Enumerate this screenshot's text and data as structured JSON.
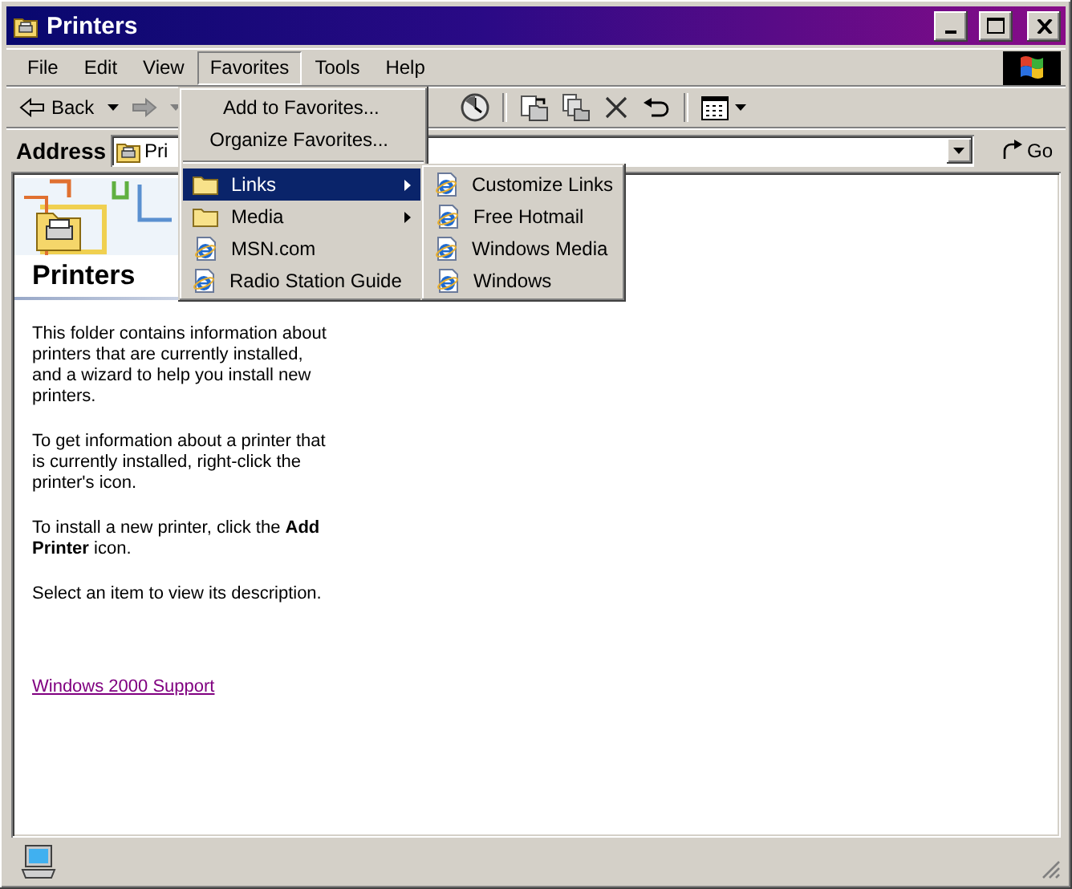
{
  "window": {
    "title": "Printers"
  },
  "menu_bar": [
    {
      "label": "File",
      "selected": false
    },
    {
      "label": "Edit",
      "selected": false
    },
    {
      "label": "View",
      "selected": false
    },
    {
      "label": "Favorites",
      "selected": true
    },
    {
      "label": "Tools",
      "selected": false
    },
    {
      "label": "Help",
      "selected": false
    }
  ],
  "toolbar": {
    "back_label": "Back"
  },
  "address_bar": {
    "label": "Address",
    "value": "Pri",
    "go_label": "Go"
  },
  "favorites_menu": [
    {
      "kind": "command",
      "label": "Add to Favorites...",
      "selected": false
    },
    {
      "kind": "command",
      "label": "Organize Favorites...",
      "selected": false
    },
    {
      "kind": "separator"
    },
    {
      "kind": "folder",
      "label": "Links",
      "selected": true,
      "children": [
        {
          "kind": "link",
          "label": "Customize Links",
          "selected": false
        },
        {
          "kind": "link",
          "label": "Free Hotmail",
          "selected": false
        },
        {
          "kind": "link",
          "label": "Windows Media",
          "selected": false
        },
        {
          "kind": "link",
          "label": "Windows",
          "selected": false
        }
      ]
    },
    {
      "kind": "folder",
      "label": "Media",
      "selected": false
    },
    {
      "kind": "link",
      "label": "MSN.com",
      "selected": false
    },
    {
      "kind": "link",
      "label": "Radio Station Guide",
      "selected": false
    }
  ],
  "panel": {
    "title": "Printers",
    "paragraphs": [
      "This folder contains information about printers that are currently installed, and a wizard to help you install new printers.",
      "To get information about a printer that is currently installed, right-click the printer's icon.",
      "To install a new printer, click the **Add Printer** icon.",
      "Select an item to view its description."
    ],
    "link": "Windows 2000 Support"
  }
}
